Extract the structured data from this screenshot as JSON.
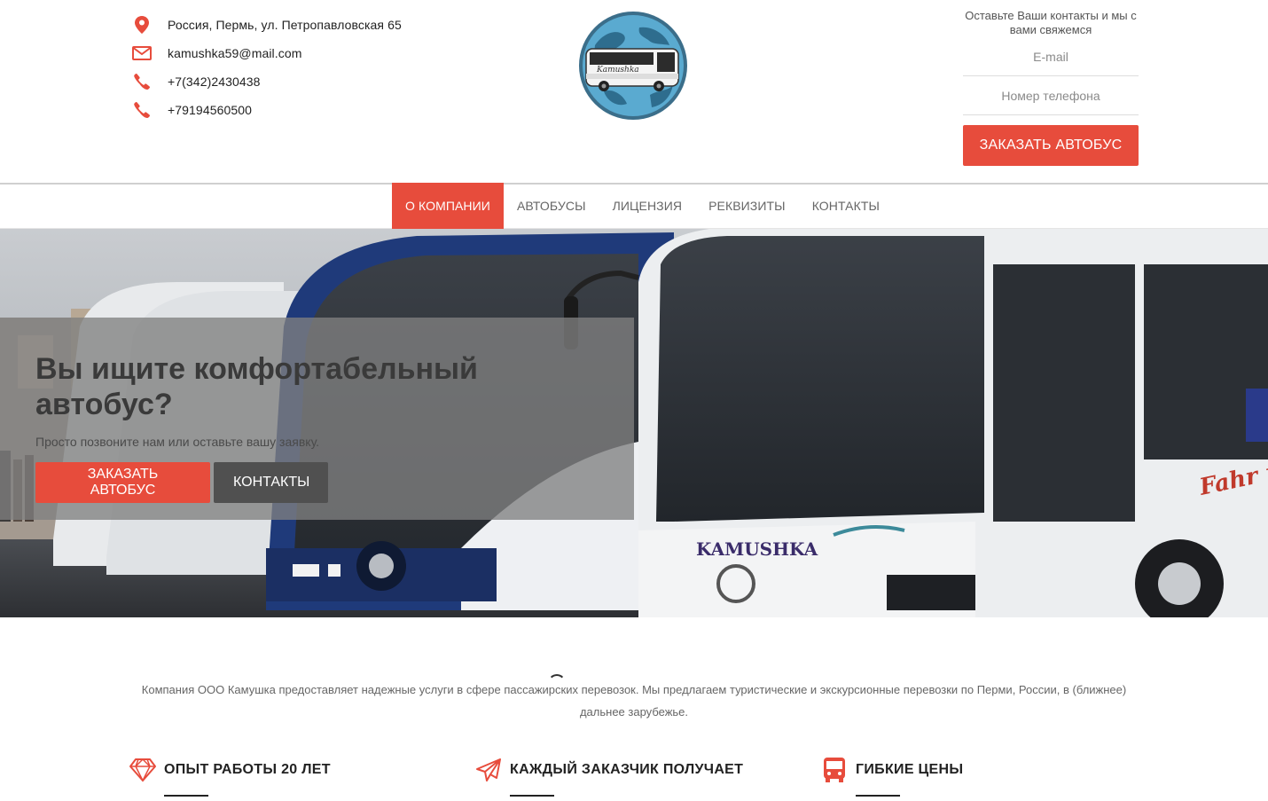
{
  "header": {
    "contacts": [
      {
        "icon": "map-pin-icon",
        "text": "Россия, Пермь, ул. Петропавловская 65"
      },
      {
        "icon": "envelope-icon",
        "text": "kamushka59@mail.com"
      },
      {
        "icon": "phone-icon",
        "text": "+7(342)2430438"
      },
      {
        "icon": "phone-icon",
        "text": "+79194560500"
      }
    ],
    "logo": {
      "text": "Kamushka"
    },
    "callback": {
      "title": "Оставьте Ваши контакты и мы с вами свяжемся",
      "email_placeholder": "E-mail",
      "phone_placeholder": "Номер телефона",
      "button_label": "ЗАКАЗАТЬ АВТОБУС"
    }
  },
  "nav": {
    "items": [
      {
        "label": "О КОМПАНИИ",
        "active": true
      },
      {
        "label": "АВТОБУСЫ",
        "active": false
      },
      {
        "label": "ЛИЦЕНЗИЯ",
        "active": false
      },
      {
        "label": "РЕКВИЗИТЫ",
        "active": false
      },
      {
        "label": "КОНТАКТЫ",
        "active": false
      }
    ]
  },
  "hero": {
    "title": "Вы ищите комфортабельный автобус?",
    "subtitle": "Просто позвоните нам или оставьте вашу заявку.",
    "order_button": "ЗАКАЗАТЬ АВТОБУС",
    "contacts_button": "КОНТАКТЫ",
    "bus_brand_text": "KAMUSHKA",
    "bus_side_text": "Fahr m"
  },
  "about": {
    "text": "Компания ООО Камушка предоставляет надежные услуги в сфере пассажирских перевозок. Мы предлагаем туристические и экскурсионные перевозки по Перми, России, в (ближнее) дальнее зарубежье.",
    "features": [
      {
        "icon": "diamond-icon",
        "title": "ОПЫТ РАБОТЫ 20 ЛЕТ"
      },
      {
        "icon": "paper-plane-icon",
        "title": "КАЖДЫЙ ЗАКАЗЧИК ПОЛУЧАЕТ"
      },
      {
        "icon": "bus-icon",
        "title": "ГИБКИЕ ЦЕНЫ"
      }
    ]
  },
  "colors": {
    "accent": "#e74c3c",
    "dark_button": "#505050",
    "logo_circle": "#5aaad0"
  }
}
